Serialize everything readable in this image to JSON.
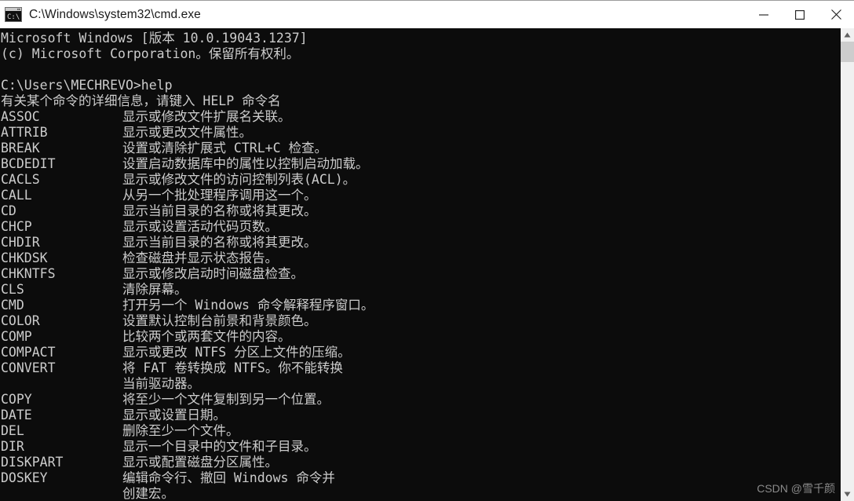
{
  "window": {
    "title": "C:\\Windows\\system32\\cmd.exe",
    "icon": "cmd-console-icon",
    "background_color": "#0c0c0c",
    "text_color": "#cccccc",
    "titlebar_color": "#ffffff",
    "controls": {
      "minimize_label": "—",
      "maximize_label": "□",
      "close_label": "✕"
    }
  },
  "scrollbar": {
    "up_arrow": "scroll-up-arrow",
    "down_arrow": "scroll-down-arrow",
    "thumb_color": "#cdcdcd",
    "track_color": "#f0f0f0"
  },
  "watermark": {
    "text": "CSDN @雪千颜"
  },
  "console": {
    "header": [
      "Microsoft Windows [版本 10.0.19043.1237]",
      "(c) Microsoft Corporation。保留所有权利。",
      "",
      "C:\\Users\\MECHREVO>help",
      "有关某个命令的详细信息，请键入 HELP 命令名"
    ],
    "prompt": "C:\\Users\\MECHREVO>",
    "command": "help",
    "commands": [
      {
        "name": "ASSOC",
        "description": "显示或修改文件扩展名关联。"
      },
      {
        "name": "ATTRIB",
        "description": "显示或更改文件属性。"
      },
      {
        "name": "BREAK",
        "description": "设置或清除扩展式 CTRL+C 检查。"
      },
      {
        "name": "BCDEDIT",
        "description": "设置启动数据库中的属性以控制启动加载。"
      },
      {
        "name": "CACLS",
        "description": "显示或修改文件的访问控制列表(ACL)。"
      },
      {
        "name": "CALL",
        "description": "从另一个批处理程序调用这一个。"
      },
      {
        "name": "CD",
        "description": "显示当前目录的名称或将其更改。"
      },
      {
        "name": "CHCP",
        "description": "显示或设置活动代码页数。"
      },
      {
        "name": "CHDIR",
        "description": "显示当前目录的名称或将其更改。"
      },
      {
        "name": "CHKDSK",
        "description": "检查磁盘并显示状态报告。"
      },
      {
        "name": "CHKNTFS",
        "description": "显示或修改启动时间磁盘检查。"
      },
      {
        "name": "CLS",
        "description": "清除屏幕。"
      },
      {
        "name": "CMD",
        "description": "打开另一个 Windows 命令解释程序窗口。"
      },
      {
        "name": "COLOR",
        "description": "设置默认控制台前景和背景颜色。"
      },
      {
        "name": "COMP",
        "description": "比较两个或两套文件的内容。"
      },
      {
        "name": "COMPACT",
        "description": "显示或更改 NTFS 分区上文件的压缩。"
      },
      {
        "name": "CONVERT",
        "description": "将 FAT 卷转换成 NTFS。你不能转换",
        "continuation": "当前驱动器。"
      },
      {
        "name": "COPY",
        "description": "将至少一个文件复制到另一个位置。"
      },
      {
        "name": "DATE",
        "description": "显示或设置日期。"
      },
      {
        "name": "DEL",
        "description": "删除至少一个文件。"
      },
      {
        "name": "DIR",
        "description": "显示一个目录中的文件和子目录。"
      },
      {
        "name": "DISKPART",
        "description": "显示或配置磁盘分区属性。"
      },
      {
        "name": "DOSKEY",
        "description": "编辑命令行、撤回 Windows 命令并",
        "continuation": "创建宏。"
      }
    ]
  }
}
